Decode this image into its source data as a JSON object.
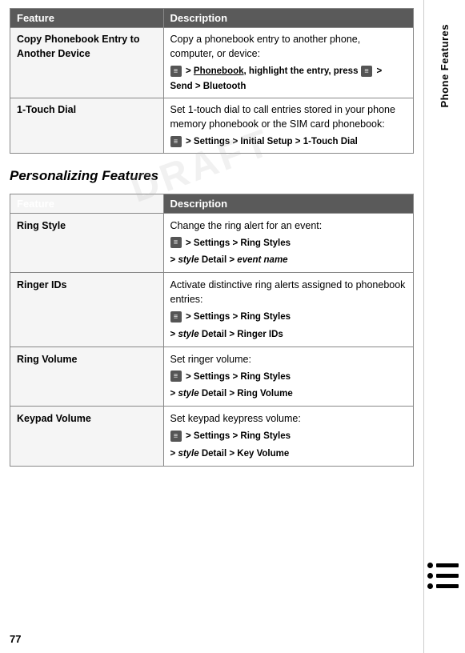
{
  "page": {
    "number": "77",
    "sidebar_label": "Phone Features",
    "draft_text": "DRAFT"
  },
  "top_table": {
    "header": {
      "feature": "Feature",
      "description": "Description"
    },
    "rows": [
      {
        "feature": "Copy Phonebook Entry to Another Device",
        "description_text": "Copy a phonebook entry to another phone, computer, or device:",
        "menu_line1": "> Phonebook, highlight the entry, press",
        "menu_line2": "> Send > Bluetooth"
      },
      {
        "feature": "1-Touch Dial",
        "description_text": "Set 1-touch dial to call entries stored in your phone memory phonebook or the SIM card phonebook:",
        "menu_line1": "> Settings > Initial Setup > 1-Touch Dial"
      }
    ]
  },
  "section_heading": "Personalizing Features",
  "features_table": {
    "header": {
      "feature": "Feature",
      "description": "Description"
    },
    "rows": [
      {
        "feature": "Ring Style",
        "description_text": "Change the ring alert for an event:",
        "menu_lines": [
          "> Settings > Ring Styles",
          "> style Detail > event name"
        ]
      },
      {
        "feature": "Ringer IDs",
        "description_text": "Activate distinctive ring alerts assigned to phonebook entries:",
        "menu_lines": [
          "> Settings > Ring Styles",
          "> style Detail > Ringer IDs"
        ]
      },
      {
        "feature": "Ring Volume",
        "description_text": "Set ringer volume:",
        "menu_lines": [
          "> Settings > Ring Styles",
          "> style Detail > Ring Volume"
        ]
      },
      {
        "feature": "Keypad Volume",
        "description_text": "Set keypad keypress volume:",
        "menu_lines": [
          "> Settings > Ring Styles",
          "> style Detail > Key Volume"
        ]
      }
    ]
  }
}
